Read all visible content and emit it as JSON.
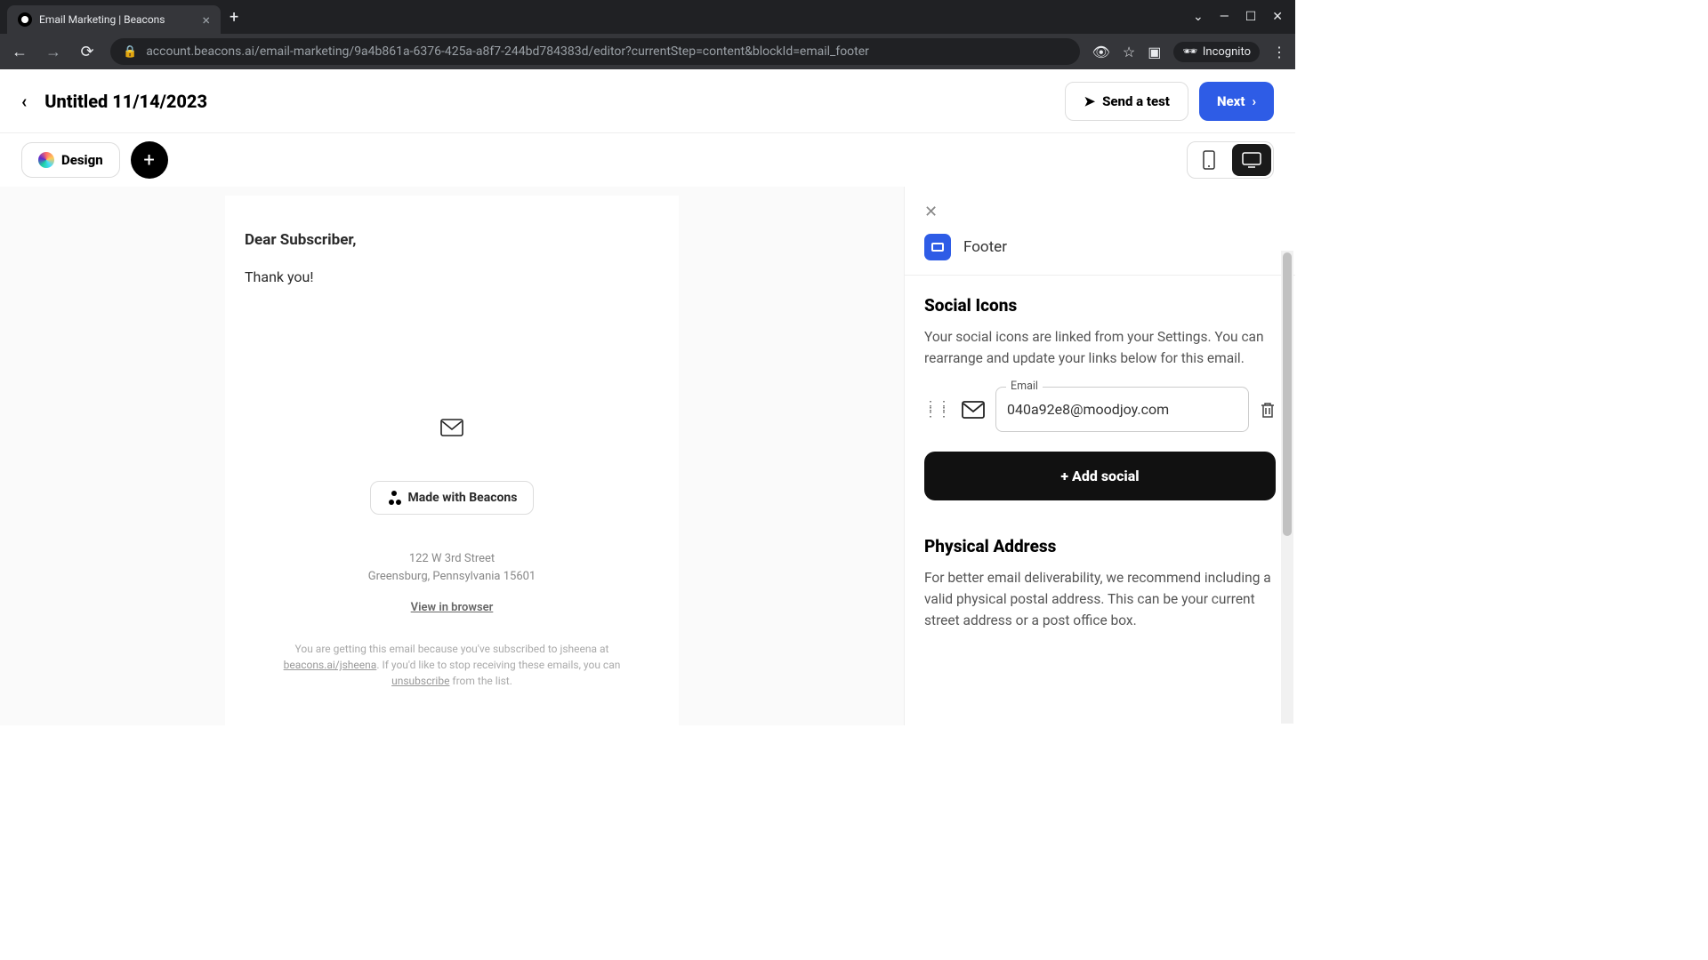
{
  "browser": {
    "tab_title": "Email Marketing | Beacons",
    "url": "account.beacons.ai/email-marketing/9a4b861a-6376-425a-a8f7-244bd784383d/editor?currentStep=content&blockId=email_footer",
    "incognito_label": "Incognito"
  },
  "header": {
    "doc_title": "Untitled 11/14/2023",
    "send_test": "Send a test",
    "next": "Next"
  },
  "toolbar": {
    "design": "Design"
  },
  "email": {
    "greeting": "Dear Subscriber,",
    "body": "Thank you!",
    "made_with": "Made with Beacons",
    "address_line1": "122 W 3rd Street",
    "address_line2": "Greensburg, Pennsylvania 15601",
    "view_in_browser": "View in browser",
    "fine1": "You are getting this email because you've subscribed to jsheena at ",
    "fine_link1": "beacons.ai/jsheena",
    "fine2": ". If you'd like to stop receiving these emails, you can ",
    "fine_link2": "unsubscribe",
    "fine3": " from the list."
  },
  "panel": {
    "title": "Footer",
    "social_heading": "Social Icons",
    "social_desc": "Your social icons are linked from your Settings. You can rearrange and update your links below for this email.",
    "email_label": "Email",
    "email_value": "040a92e8@moodjoy.com",
    "add_social": "+ Add social",
    "address_heading": "Physical Address",
    "address_desc": "For better email deliverability, we recommend including a valid physical postal address. This can be your current street address or a post office box."
  }
}
